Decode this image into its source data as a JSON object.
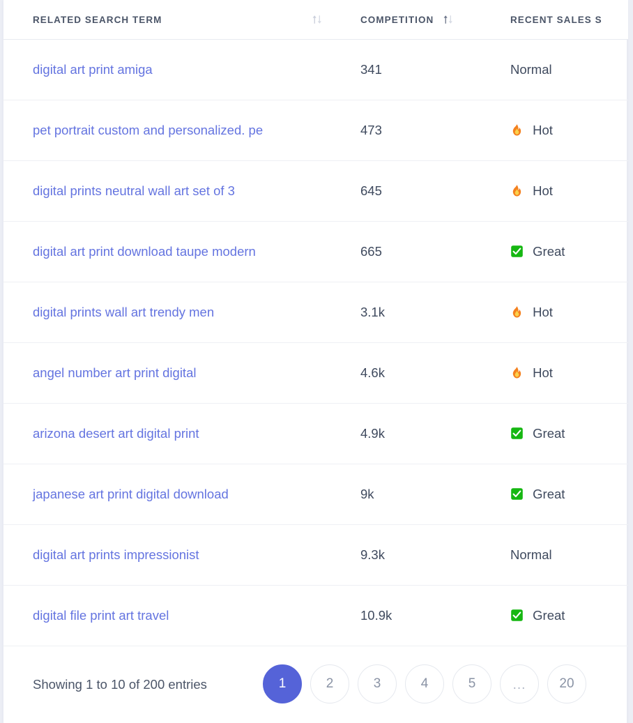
{
  "table": {
    "columns": [
      {
        "key": "term",
        "label": "RELATED SEARCH TERM",
        "sortable": true,
        "sort_state": "none"
      },
      {
        "key": "comp",
        "label": "COMPETITION",
        "sortable": true,
        "sort_state": "asc"
      },
      {
        "key": "sales",
        "label": "RECENT SALES S",
        "sortable": false,
        "sort_state": "none"
      }
    ],
    "rows": [
      {
        "term": "digital art print amiga",
        "competition": "341",
        "sales_status": "Normal",
        "status_icon": "none"
      },
      {
        "term": "pet portrait custom and personalized. pe",
        "competition": "473",
        "sales_status": "Hot",
        "status_icon": "fire"
      },
      {
        "term": "digital prints neutral wall art set of 3",
        "competition": "645",
        "sales_status": "Hot",
        "status_icon": "fire"
      },
      {
        "term": "digital art print download taupe modern",
        "competition": "665",
        "sales_status": "Great",
        "status_icon": "check"
      },
      {
        "term": "digital prints wall art trendy men",
        "competition": "3.1k",
        "sales_status": "Hot",
        "status_icon": "fire"
      },
      {
        "term": "angel number art print digital",
        "competition": "4.6k",
        "sales_status": "Hot",
        "status_icon": "fire"
      },
      {
        "term": "arizona desert art digital print",
        "competition": "4.9k",
        "sales_status": "Great",
        "status_icon": "check"
      },
      {
        "term": "japanese art print digital download",
        "competition": "9k",
        "sales_status": "Great",
        "status_icon": "check"
      },
      {
        "term": "digital art prints impressionist",
        "competition": "9.3k",
        "sales_status": "Normal",
        "status_icon": "none"
      },
      {
        "term": "digital file print art travel",
        "competition": "10.9k",
        "sales_status": "Great",
        "status_icon": "check"
      }
    ]
  },
  "footer": {
    "showing_text": "Showing 1 to 10 of 200 entries",
    "pages": [
      {
        "label": "1",
        "active": true
      },
      {
        "label": "2",
        "active": false
      },
      {
        "label": "3",
        "active": false
      },
      {
        "label": "4",
        "active": false
      },
      {
        "label": "5",
        "active": false
      },
      {
        "label": "...",
        "active": false
      },
      {
        "label": "20",
        "active": false
      }
    ]
  },
  "colors": {
    "accent": "#5563d8",
    "link": "#6474e0",
    "text": "#3f4a5e",
    "header_text": "#4b5568",
    "border": "#eef0f4",
    "page_bg": "#eceef5",
    "great_green": "#16b712",
    "hot_orange": "#f4811f"
  }
}
